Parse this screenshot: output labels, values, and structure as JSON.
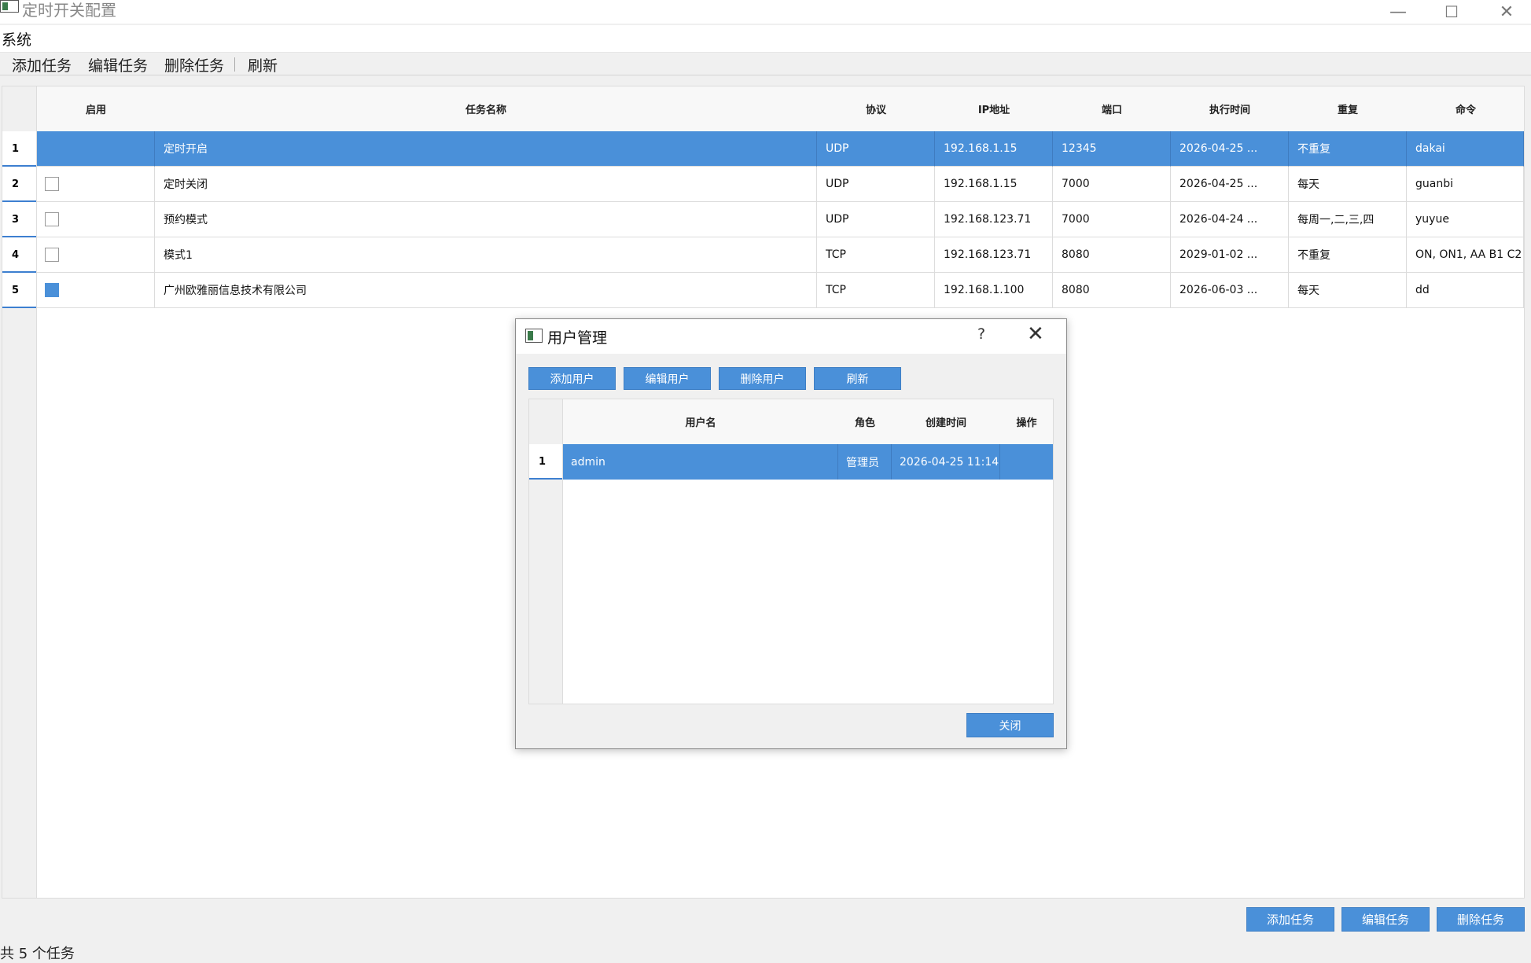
{
  "window": {
    "title": "定时开关配置",
    "minimize": "—",
    "maximize": "☐",
    "close": "✕"
  },
  "menu": {
    "system": "系统"
  },
  "toolbar": {
    "add": "添加任务",
    "edit": "编辑任务",
    "delete": "删除任务",
    "refresh": "刷新"
  },
  "task_table": {
    "headers": {
      "enabled": "启用",
      "name": "任务名称",
      "protocol": "协议",
      "ip": "IP地址",
      "port": "端口",
      "time": "执行时间",
      "repeat": "重复",
      "command": "命令"
    },
    "rows": [
      {
        "num": "1",
        "enabled": null,
        "name": "定时开启",
        "protocol": "UDP",
        "ip": "192.168.1.15",
        "port": "12345",
        "time": "2026-04-25 ...",
        "repeat": "不重复",
        "command": "dakai"
      },
      {
        "num": "2",
        "enabled": false,
        "name": "定时关闭",
        "protocol": "UDP",
        "ip": "192.168.1.15",
        "port": "7000",
        "time": "2026-04-25 ...",
        "repeat": "每天",
        "command": "guanbi"
      },
      {
        "num": "3",
        "enabled": false,
        "name": "预约模式",
        "protocol": "UDP",
        "ip": "192.168.123.71",
        "port": "7000",
        "time": "2026-04-24 ...",
        "repeat": "每周一,二,三,四",
        "command": "yuyue"
      },
      {
        "num": "4",
        "enabled": false,
        "name": "模式1",
        "protocol": "TCP",
        "ip": "192.168.123.71",
        "port": "8080",
        "time": "2029-01-02 ...",
        "repeat": "不重复",
        "command": "ON, ON1, AA B1 C2"
      },
      {
        "num": "5",
        "enabled": true,
        "name": "广州欧雅丽信息技术有限公司",
        "protocol": "TCP",
        "ip": "192.168.1.100",
        "port": "8080",
        "time": "2026-06-03 ...",
        "repeat": "每天",
        "command": "dd"
      }
    ]
  },
  "bottom_buttons": {
    "add": "添加任务",
    "edit": "编辑任务",
    "delete": "删除任务"
  },
  "status": {
    "text": "共 5 个任务"
  },
  "dialog": {
    "title": "用户管理",
    "help": "?",
    "close_x": "✕",
    "buttons": {
      "add": "添加用户",
      "edit": "编辑用户",
      "delete": "删除用户",
      "refresh": "刷新"
    },
    "table": {
      "headers": {
        "username": "用户名",
        "role": "角色",
        "created": "创建时间",
        "action": "操作"
      },
      "rows": [
        {
          "num": "1",
          "username": "admin",
          "role": "管理员",
          "created": "2026-04-25 11:14",
          "action": ""
        }
      ]
    },
    "close_button": "关闭"
  },
  "colors": {
    "accent": "#4a90d9",
    "background": "#f0f0f0"
  }
}
